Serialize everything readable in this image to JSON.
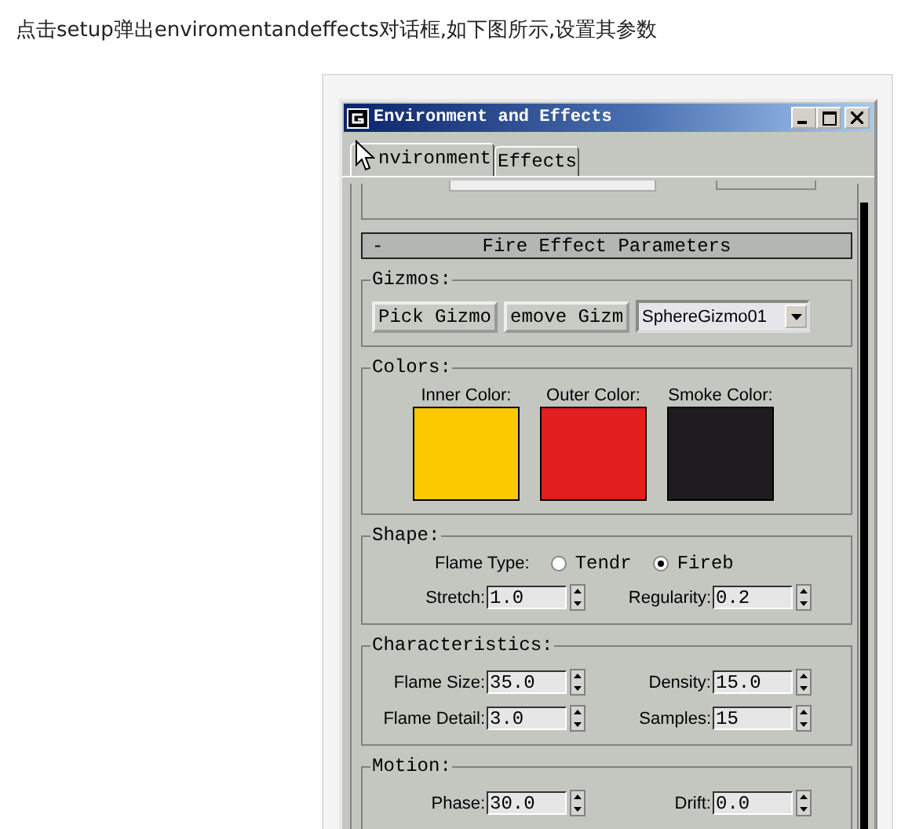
{
  "caption": "点击setup弹出enviromentandeffects对话框,如下图所示,设置其参数",
  "window": {
    "title": "Environment and Effects"
  },
  "tabs": [
    {
      "label": "nvironment",
      "selected": true
    },
    {
      "label": "Effects",
      "selected": false
    }
  ],
  "rollout": {
    "title": "Fire Effect Parameters",
    "collapse": "-"
  },
  "gizmos": {
    "title": "Gizmos:",
    "buttons": [
      "Pick Gizmo",
      "emove Gizm"
    ],
    "dropdown": "SphereGizmo01"
  },
  "colors": {
    "title": "Colors:",
    "swatches": [
      {
        "label": "Inner Color:",
        "color": "#fcc800"
      },
      {
        "label": "Outer Color:",
        "color": "#e31e1e"
      },
      {
        "label": "Smoke Color:",
        "color": "#1e1c20"
      }
    ]
  },
  "shape": {
    "title": "Shape:",
    "flame_type_label": "Flame Type:",
    "options": [
      {
        "label": "Tendr",
        "selected": false
      },
      {
        "label": "Fireb",
        "selected": true
      }
    ],
    "spinners": [
      [
        {
          "label": "Stretch:",
          "value": "1.0"
        },
        {
          "label": "Regularity:",
          "value": "0.2"
        }
      ]
    ]
  },
  "characteristics": {
    "title": "Characteristics:",
    "spinners": [
      [
        {
          "label": "Flame Size:",
          "value": "35.0"
        },
        {
          "label": "Density:",
          "value": "15.0"
        }
      ],
      [
        {
          "label": "Flame Detail:",
          "value": "3.0"
        },
        {
          "label": "Samples:",
          "value": "15"
        }
      ]
    ]
  },
  "motion": {
    "title": "Motion:",
    "spinners": [
      [
        {
          "label": "Phase:",
          "value": "30.0"
        },
        {
          "label": "Drift:",
          "value": "0.0"
        }
      ]
    ]
  }
}
